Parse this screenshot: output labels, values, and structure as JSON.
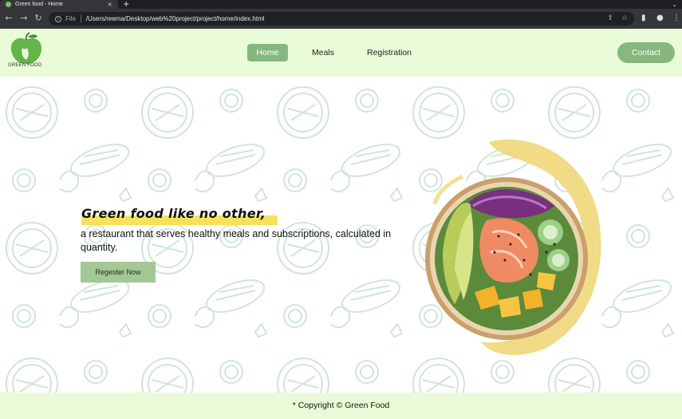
{
  "browser": {
    "tab_title": "Green food - Home",
    "tab_close": "×",
    "new_tab": "+",
    "tabs_menu": "⌄",
    "back_icon": "←",
    "forward_icon": "→",
    "reload_icon": "↻",
    "url_scheme_label": "File",
    "url": "/Users/reema/Desktop/web%20project/project/home/index.html",
    "share_icon": "⇪",
    "bookmark_icon": "☆",
    "sidepanel_icon": "▮",
    "profile_icon": "●",
    "menu_icon": "⋮"
  },
  "site": {
    "logo_text": "GREEN FOOD",
    "nav": [
      {
        "label": "Home",
        "active": true
      },
      {
        "label": "Meals",
        "active": false
      },
      {
        "label": "Registration",
        "active": false
      }
    ],
    "contact_label": "Contact",
    "accent": "#86b77f",
    "header_bg": "#eafbd7",
    "highlight": "#f6e25a"
  },
  "hero": {
    "headline": "Green food like no other,",
    "subtext": "a restaurant that serves healthy meals and subscriptions, calculated in quantity.",
    "cta_label": "Regester Now",
    "image_icon": "poke-bowl-image"
  },
  "footer": {
    "copyright": "* Copyright © Green Food"
  }
}
